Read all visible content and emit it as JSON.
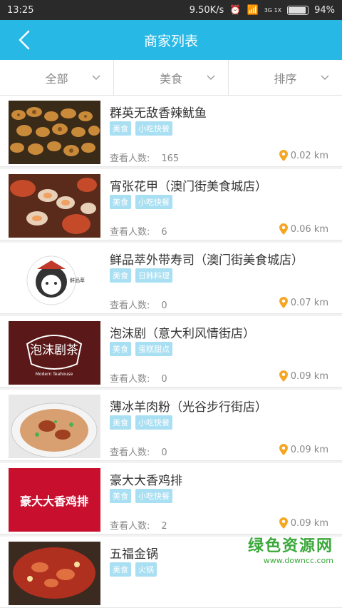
{
  "status_bar": {
    "time": "13:25",
    "speed": "9.50K/s",
    "network": "3G 1X",
    "battery": "94%",
    "battery_level": 0.94
  },
  "header": {
    "title": "商家列表"
  },
  "filters": [
    {
      "label": "全部"
    },
    {
      "label": "美食"
    },
    {
      "label": "排序"
    }
  ],
  "views_label": "查看人数:",
  "merchants": [
    {
      "name": "群英无敌香辣鱿鱼",
      "tags": [
        "美食",
        "小吃快餐"
      ],
      "views": "165",
      "distance": "0.02 km"
    },
    {
      "name": "宵张花甲（澳门街美食城店）",
      "tags": [
        "美食",
        "小吃快餐"
      ],
      "views": "6",
      "distance": "0.06 km"
    },
    {
      "name": "鲜品萃外带寿司（澳门街美食城店）",
      "tags": [
        "美食",
        "日韩料理"
      ],
      "views": "0",
      "distance": "0.07 km"
    },
    {
      "name": "泡沫剧（意大利风情街店）",
      "tags": [
        "美食",
        "蛋糕甜点"
      ],
      "views": "0",
      "distance": "0.09 km"
    },
    {
      "name": "薄冰羊肉粉（光谷步行街店）",
      "tags": [
        "美食",
        "小吃快餐"
      ],
      "views": "0",
      "distance": "0.09 km"
    },
    {
      "name": "豪大大香鸡排",
      "tags": [
        "美食",
        "小吃快餐"
      ],
      "views": "2",
      "distance": "0.09 km"
    },
    {
      "name": "五福金锅",
      "tags": [
        "美食",
        "火锅"
      ],
      "views": "",
      "distance": ""
    }
  ],
  "thumb_text": {
    "sushi_brand": "鲜品萃",
    "teahouse_cn": "泡沫剧茶",
    "teahouse_en": "Modern Teahouse",
    "chicken": "豪大大香鸡排"
  },
  "watermark": {
    "line1": "绿色资源网",
    "line2": "www.downcc.com"
  },
  "colors": {
    "header": "#27b8e6",
    "tag": "#a9dff2",
    "pin": "#f5a623",
    "watermark": "#3aa83a"
  }
}
